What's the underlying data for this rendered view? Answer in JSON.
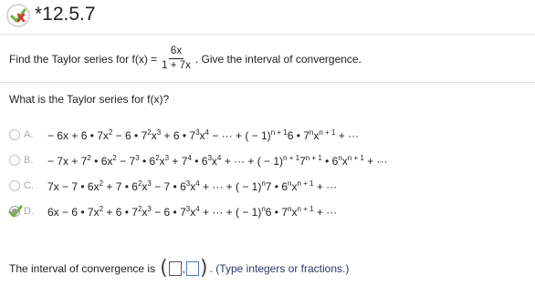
{
  "problem": {
    "id": "*12.5.7",
    "status_icon": "incorrect-icon"
  },
  "prompt": {
    "lead": "Find the Taylor series for f(x) =",
    "frac_num": "6x",
    "frac_den": "1 + 7x",
    "trail": ". Give the interval of convergence."
  },
  "question": "What is the Taylor series for f(x)?",
  "options": [
    {
      "letter": "A.",
      "selected": false
    },
    {
      "letter": "B.",
      "selected": false
    },
    {
      "letter": "C.",
      "selected": false
    },
    {
      "letter": "D.",
      "selected": true
    }
  ],
  "interval": {
    "label": "The interval of convergence is",
    "paren_open": "(",
    "separator": ",",
    "paren_close": ")",
    "hint": ". (Type integers or fractions.)"
  },
  "colors": {
    "check": "#6cb33f",
    "x_mark": "#d9322f",
    "active_box": "#4a7fc1"
  }
}
